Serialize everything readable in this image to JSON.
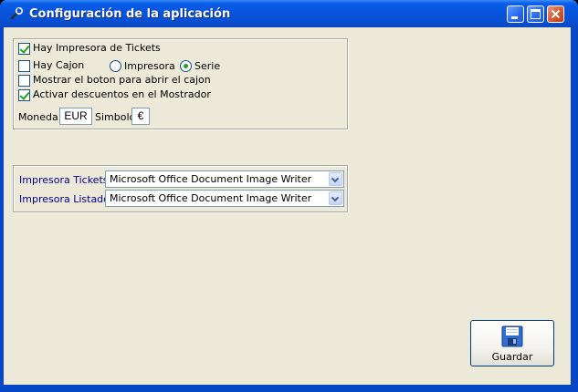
{
  "window": {
    "title": "Configuración de la aplicación"
  },
  "printer_group": {
    "has_ticket_printer": {
      "label": "Hay Impresora de Tickets",
      "checked": true
    },
    "has_drawer": {
      "label": "Hay Cajon",
      "checked": false
    },
    "drawer_mode": {
      "options": [
        "Impresora",
        "Serie"
      ],
      "selected": "Serie"
    },
    "show_drawer_button": {
      "label": "Mostrar el boton para abrir el cajon",
      "checked": false
    },
    "enable_discounts": {
      "label": "Activar descuentos en el Mostrador",
      "checked": true
    },
    "currency_label": "Moneda",
    "currency_value": "EUR",
    "symbol_label": "Simbolo",
    "symbol_value": "€"
  },
  "printers": {
    "tickets_label": "Impresora Tickets",
    "tickets_value": "Microsoft Office Document Image Writer",
    "listing_label": "Impresora Listado",
    "listing_value": "Microsoft Office Document Image Writer"
  },
  "actions": {
    "save_label": "Guardar"
  },
  "icons": {
    "app": "wrench-icon",
    "save": "floppy-disk-icon",
    "minimize": "minimize-icon",
    "maximize": "maximize-icon",
    "close": "close-icon"
  },
  "colors": {
    "titlebar": "#0a5ee8",
    "client_bg": "#ece9d8",
    "label_blue": "#00008b",
    "check_green": "#21a121"
  }
}
